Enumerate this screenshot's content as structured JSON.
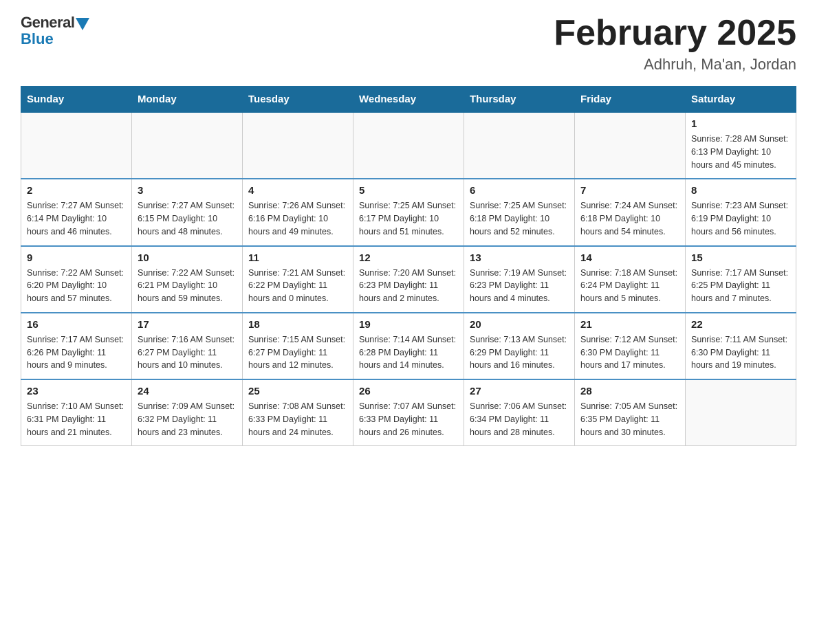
{
  "header": {
    "logo_general": "General",
    "logo_blue": "Blue",
    "month_title": "February 2025",
    "location": "Adhruh, Ma'an, Jordan"
  },
  "weekdays": [
    "Sunday",
    "Monday",
    "Tuesday",
    "Wednesday",
    "Thursday",
    "Friday",
    "Saturday"
  ],
  "weeks": [
    [
      {
        "day": "",
        "info": ""
      },
      {
        "day": "",
        "info": ""
      },
      {
        "day": "",
        "info": ""
      },
      {
        "day": "",
        "info": ""
      },
      {
        "day": "",
        "info": ""
      },
      {
        "day": "",
        "info": ""
      },
      {
        "day": "1",
        "info": "Sunrise: 7:28 AM\nSunset: 6:13 PM\nDaylight: 10 hours\nand 45 minutes."
      }
    ],
    [
      {
        "day": "2",
        "info": "Sunrise: 7:27 AM\nSunset: 6:14 PM\nDaylight: 10 hours\nand 46 minutes."
      },
      {
        "day": "3",
        "info": "Sunrise: 7:27 AM\nSunset: 6:15 PM\nDaylight: 10 hours\nand 48 minutes."
      },
      {
        "day": "4",
        "info": "Sunrise: 7:26 AM\nSunset: 6:16 PM\nDaylight: 10 hours\nand 49 minutes."
      },
      {
        "day": "5",
        "info": "Sunrise: 7:25 AM\nSunset: 6:17 PM\nDaylight: 10 hours\nand 51 minutes."
      },
      {
        "day": "6",
        "info": "Sunrise: 7:25 AM\nSunset: 6:18 PM\nDaylight: 10 hours\nand 52 minutes."
      },
      {
        "day": "7",
        "info": "Sunrise: 7:24 AM\nSunset: 6:18 PM\nDaylight: 10 hours\nand 54 minutes."
      },
      {
        "day": "8",
        "info": "Sunrise: 7:23 AM\nSunset: 6:19 PM\nDaylight: 10 hours\nand 56 minutes."
      }
    ],
    [
      {
        "day": "9",
        "info": "Sunrise: 7:22 AM\nSunset: 6:20 PM\nDaylight: 10 hours\nand 57 minutes."
      },
      {
        "day": "10",
        "info": "Sunrise: 7:22 AM\nSunset: 6:21 PM\nDaylight: 10 hours\nand 59 minutes."
      },
      {
        "day": "11",
        "info": "Sunrise: 7:21 AM\nSunset: 6:22 PM\nDaylight: 11 hours\nand 0 minutes."
      },
      {
        "day": "12",
        "info": "Sunrise: 7:20 AM\nSunset: 6:23 PM\nDaylight: 11 hours\nand 2 minutes."
      },
      {
        "day": "13",
        "info": "Sunrise: 7:19 AM\nSunset: 6:23 PM\nDaylight: 11 hours\nand 4 minutes."
      },
      {
        "day": "14",
        "info": "Sunrise: 7:18 AM\nSunset: 6:24 PM\nDaylight: 11 hours\nand 5 minutes."
      },
      {
        "day": "15",
        "info": "Sunrise: 7:17 AM\nSunset: 6:25 PM\nDaylight: 11 hours\nand 7 minutes."
      }
    ],
    [
      {
        "day": "16",
        "info": "Sunrise: 7:17 AM\nSunset: 6:26 PM\nDaylight: 11 hours\nand 9 minutes."
      },
      {
        "day": "17",
        "info": "Sunrise: 7:16 AM\nSunset: 6:27 PM\nDaylight: 11 hours\nand 10 minutes."
      },
      {
        "day": "18",
        "info": "Sunrise: 7:15 AM\nSunset: 6:27 PM\nDaylight: 11 hours\nand 12 minutes."
      },
      {
        "day": "19",
        "info": "Sunrise: 7:14 AM\nSunset: 6:28 PM\nDaylight: 11 hours\nand 14 minutes."
      },
      {
        "day": "20",
        "info": "Sunrise: 7:13 AM\nSunset: 6:29 PM\nDaylight: 11 hours\nand 16 minutes."
      },
      {
        "day": "21",
        "info": "Sunrise: 7:12 AM\nSunset: 6:30 PM\nDaylight: 11 hours\nand 17 minutes."
      },
      {
        "day": "22",
        "info": "Sunrise: 7:11 AM\nSunset: 6:30 PM\nDaylight: 11 hours\nand 19 minutes."
      }
    ],
    [
      {
        "day": "23",
        "info": "Sunrise: 7:10 AM\nSunset: 6:31 PM\nDaylight: 11 hours\nand 21 minutes."
      },
      {
        "day": "24",
        "info": "Sunrise: 7:09 AM\nSunset: 6:32 PM\nDaylight: 11 hours\nand 23 minutes."
      },
      {
        "day": "25",
        "info": "Sunrise: 7:08 AM\nSunset: 6:33 PM\nDaylight: 11 hours\nand 24 minutes."
      },
      {
        "day": "26",
        "info": "Sunrise: 7:07 AM\nSunset: 6:33 PM\nDaylight: 11 hours\nand 26 minutes."
      },
      {
        "day": "27",
        "info": "Sunrise: 7:06 AM\nSunset: 6:34 PM\nDaylight: 11 hours\nand 28 minutes."
      },
      {
        "day": "28",
        "info": "Sunrise: 7:05 AM\nSunset: 6:35 PM\nDaylight: 11 hours\nand 30 minutes."
      },
      {
        "day": "",
        "info": ""
      }
    ]
  ]
}
